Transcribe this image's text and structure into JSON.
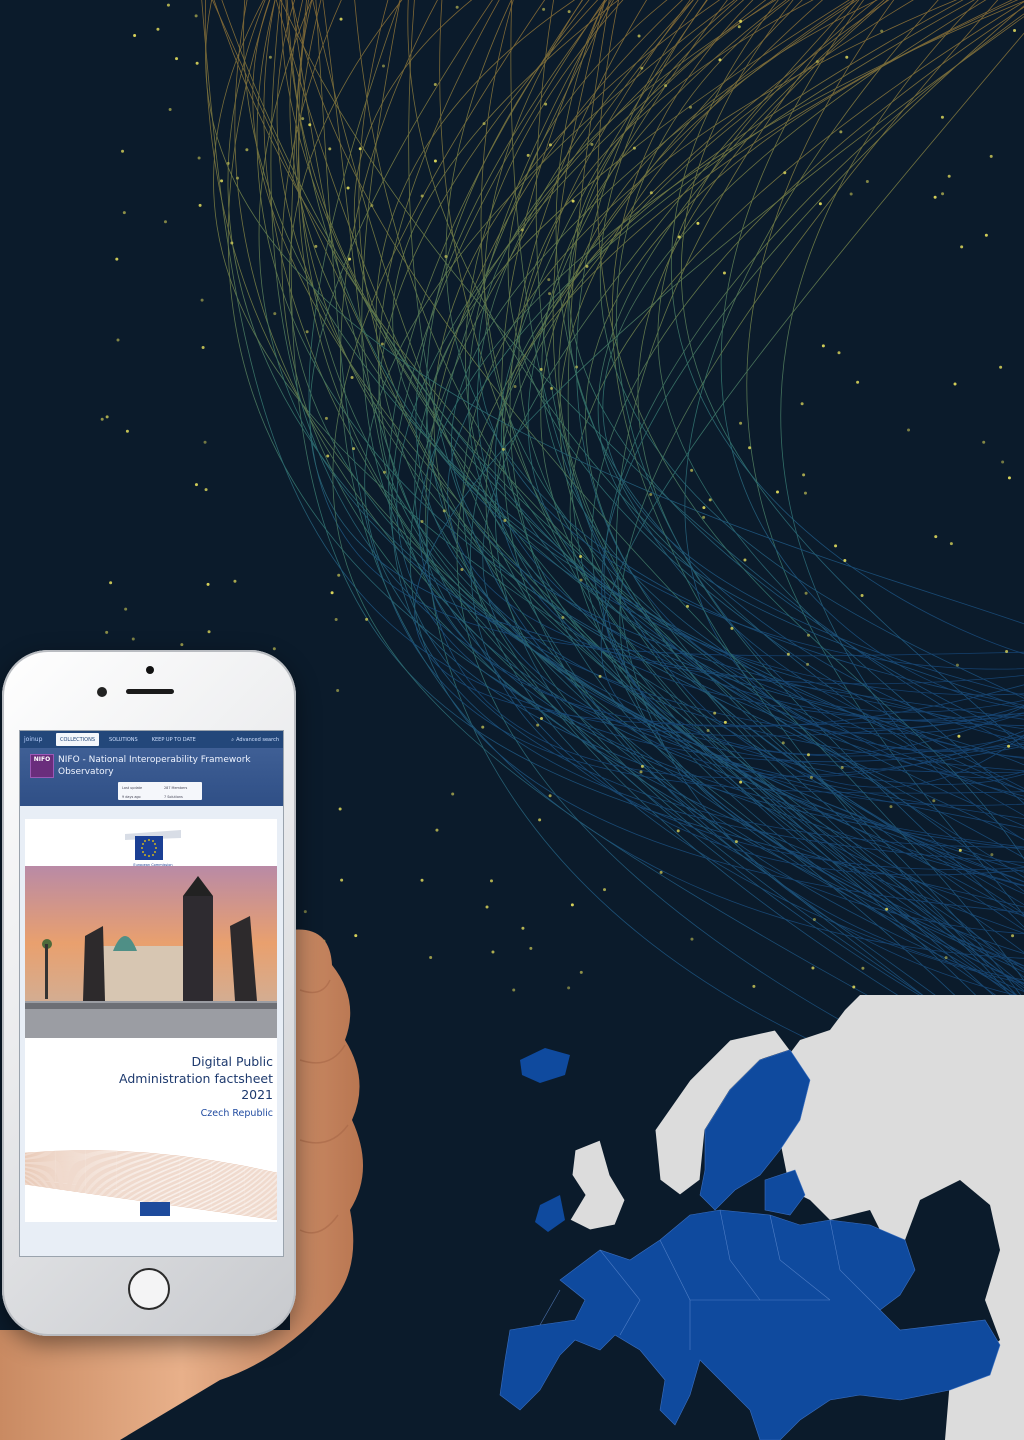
{
  "colors": {
    "background": "#0b1b2b",
    "eu_blue": "#0f4a9e",
    "non_eu_grey": "#dcdcdc",
    "header_blue": "#23477a"
  },
  "phone": {
    "topbar": {
      "logo": "joinup",
      "tabs": [
        "COLLECTIONS",
        "SOLUTIONS",
        "KEEP UP TO DATE"
      ],
      "search": "Advanced search"
    },
    "header": {
      "badge": "NIFO",
      "title": "NIFO - National Interoperability Framework Observatory",
      "meta_left_label": "Last update",
      "meta_left_value": "9 days ago",
      "meta_right_top": "287 Members",
      "meta_right_bottom": "7 Solutions"
    },
    "document": {
      "ec_label": "European Commission",
      "title_line1": "Digital Public",
      "title_line2": "Administration factsheet",
      "title_line3": "2021",
      "country": "Czech Republic"
    }
  }
}
